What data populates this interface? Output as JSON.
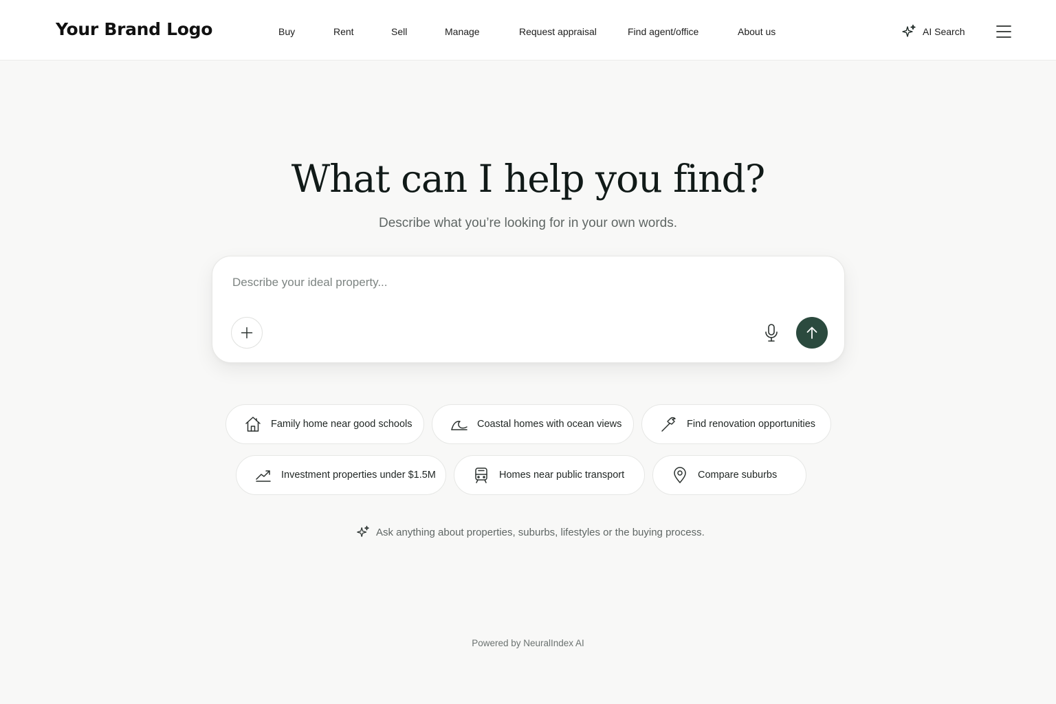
{
  "header": {
    "logo": "Your Brand Logo",
    "nav": [
      {
        "label": "Buy"
      },
      {
        "label": "Rent"
      },
      {
        "label": "Sell"
      },
      {
        "label": "Manage"
      },
      {
        "label": "Request appraisal"
      },
      {
        "label": "Find agent/office"
      },
      {
        "label": "About us"
      }
    ],
    "ai_search": {
      "label": "AI Search",
      "icon": "sparkle-icon"
    },
    "menu": {
      "icon": "hamburger-menu-icon"
    }
  },
  "hero": {
    "title": "What can I help you find?",
    "subtitle": "Describe what you’re looking for in your own words."
  },
  "search": {
    "placeholder": "Describe your ideal property...",
    "value": "",
    "add_icon": "plus-icon",
    "mic_icon": "microphone-icon",
    "send_icon": "arrow-up-icon"
  },
  "suggestions": [
    {
      "label": "Family home near good schools",
      "icon": "house-icon"
    },
    {
      "label": "Coastal homes with ocean views",
      "icon": "wave-icon"
    },
    {
      "label": "Find renovation opportunities",
      "icon": "hammer-icon"
    },
    {
      "label": "Investment properties under $1.5M",
      "icon": "trend-up-icon"
    },
    {
      "label": "Homes near public transport",
      "icon": "train-icon"
    },
    {
      "label": "Compare suburbs",
      "icon": "map-pin-icon"
    }
  ],
  "hint": {
    "text": "Ask anything about properties, suburbs, lifestyles or the buying process.",
    "icon": "sparkle-icon"
  },
  "footer": {
    "text": "Powered by NeuralIndex AI"
  },
  "colors": {
    "accent": "#2b4a3e",
    "background": "#f8f8f7",
    "text": "#1f2a27",
    "muted": "#5f6664"
  }
}
